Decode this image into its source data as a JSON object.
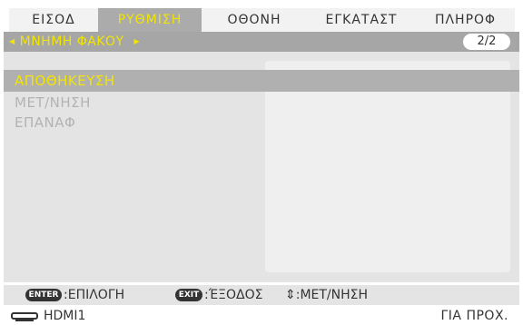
{
  "tabs": [
    {
      "label": "ΕΙΣΟΔ",
      "active": false
    },
    {
      "label": "ΡΥΘΜΙΣΗ",
      "active": true
    },
    {
      "label": "ΟΘΟΝΗ",
      "active": false
    },
    {
      "label": "ΕΓΚΑΤΑΣΤ",
      "active": false
    },
    {
      "label": "ΠΛΗΡΟΦ",
      "active": false
    }
  ],
  "submenu": {
    "left_arrow": "◀",
    "title": "ΜΝΗΜΗ ΦΑΚΟΥ",
    "right_arrow": "▶",
    "page": "2/2"
  },
  "menu": {
    "items": [
      {
        "label": "ΑΠΟΘΗΚΕΥΣΗ",
        "state": "selected"
      },
      {
        "label": "ΜΕΤ/ΝΗΣΗ",
        "state": "disabled"
      },
      {
        "label": "ΕΠΑΝΑΦ",
        "state": "disabled"
      }
    ]
  },
  "help": {
    "enter_key": "ENTER",
    "enter_text": ":ΕΠΙΛΟΓΗ",
    "exit_key": "EXIT",
    "exit_text": ":ΈΞΟΔΟΣ",
    "move_text": "⇕:ΜΕΤ/ΝΗΣΗ"
  },
  "status": {
    "input_icon": "hdmi-icon",
    "input": "HDMI1",
    "right": "ΓΙΑ ΠΡΟΧ."
  },
  "colors": {
    "accent": "#f2e500",
    "selected_bg": "#b0b0b0",
    "subbar_bg": "#a6a6a6",
    "panel_bg": "#e4e4e4",
    "disabled_text": "#b3b3b3"
  }
}
